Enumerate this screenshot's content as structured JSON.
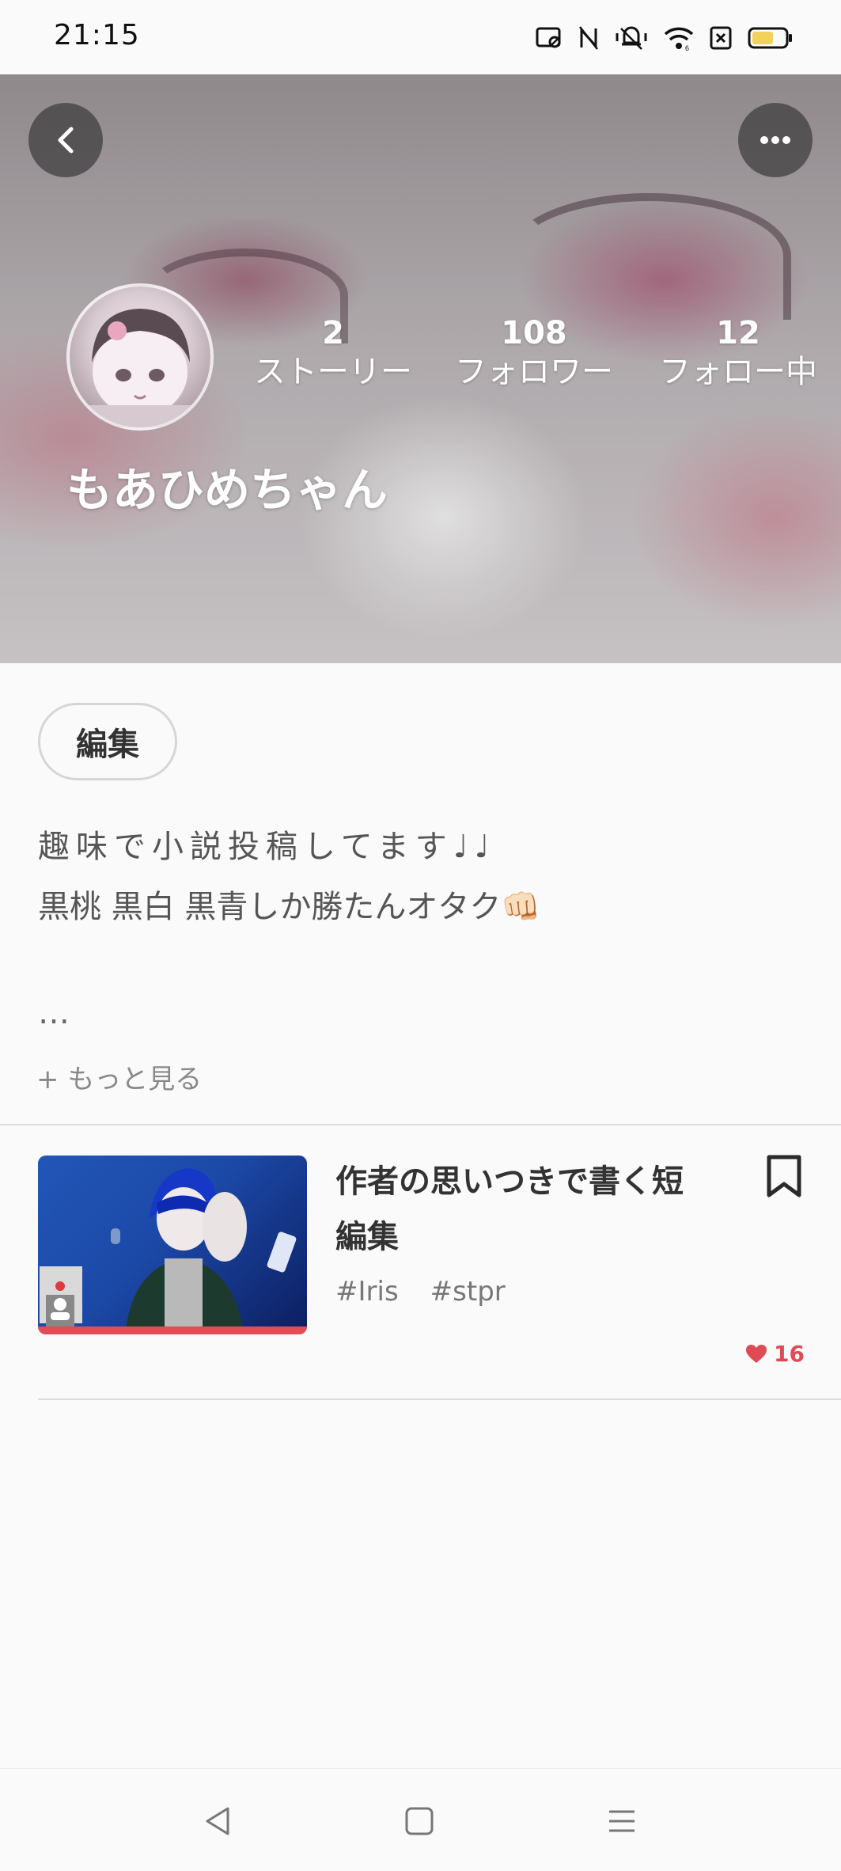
{
  "status_bar": {
    "time": "21:15",
    "icons": [
      "screen-cast-icon",
      "nfc-icon",
      "vibrate-icon",
      "wifi-icon",
      "no-sim-icon",
      "battery-icon"
    ],
    "battery_color": "#f2d15c"
  },
  "header": {
    "back_icon": "chevron-left-icon",
    "more_icon": "more-dots-icon"
  },
  "profile": {
    "username": "もあひめちゃん",
    "stats": [
      {
        "count": "2",
        "label": "ストーリー"
      },
      {
        "count": "108",
        "label": "フォロワー"
      },
      {
        "count": "12",
        "label": "フォロー中"
      }
    ],
    "edit_label": "編集",
    "bio": [
      "趣味で小説投稿してます♩♩",
      "黒桃 黒白 黒青しか勝たんオタク👊🏻",
      "…"
    ],
    "see_more": "+ もっと見る"
  },
  "stories": [
    {
      "title": "作者の思いつきで書く短編集",
      "tags": [
        "#Iris",
        "#stpr"
      ],
      "likes": "16",
      "bookmark_icon": "bookmark-icon",
      "accent_color": "#e34b55"
    }
  ],
  "nav_bar": {
    "icons": [
      "nav-back-icon",
      "nav-home-icon",
      "nav-menu-icon"
    ]
  }
}
